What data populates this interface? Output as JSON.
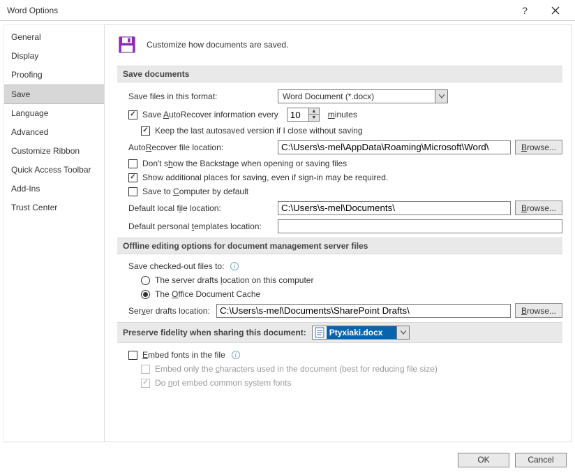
{
  "titlebar": {
    "title": "Word Options",
    "help": "?",
    "close": "×"
  },
  "sidebar": {
    "items": [
      {
        "label": "General"
      },
      {
        "label": "Display"
      },
      {
        "label": "Proofing"
      },
      {
        "label": "Save"
      },
      {
        "label": "Language"
      },
      {
        "label": "Advanced"
      },
      {
        "label": "Customize Ribbon"
      },
      {
        "label": "Quick Access Toolbar"
      },
      {
        "label": "Add-Ins"
      },
      {
        "label": "Trust Center"
      }
    ],
    "selected_index": 3
  },
  "intro": {
    "text": "Customize how documents are saved."
  },
  "save_docs": {
    "header": "Save documents",
    "format_label": "Save files in this format:",
    "format_value": "Word Document (*.docx)",
    "autorecover_prefix": "Save ",
    "autorecover_mid": "utoRecover information every",
    "autorecover_ul": "A",
    "autorecover_minutes": "10",
    "minutes_ul": "m",
    "minutes_rest": "inutes",
    "keep_last": "Keep the last autosaved version if I close without saving",
    "autorec_loc_pre": "Auto",
    "autorec_loc_ul": "R",
    "autorec_loc_post": "ecover file location:",
    "autorec_loc_val": "C:\\Users\\s-mel\\AppData\\Roaming\\Microsoft\\Word\\",
    "dont_show_pre": "Don't s",
    "dont_show_ul": "h",
    "dont_show_post": "ow the Backstage when opening or saving files",
    "show_additional": "Show additional places for saving, even if sign-in may be required.",
    "save_computer_pre": "Save to ",
    "save_computer_ul": "C",
    "save_computer_post": "omputer by default",
    "default_local_pre": "Default local f",
    "default_local_ul": "i",
    "default_local_post": "le location:",
    "default_local_val": "C:\\Users\\s-mel\\Documents\\",
    "default_tmpl_pre": "Default personal ",
    "default_tmpl_ul": "t",
    "default_tmpl_post": "emplates location:",
    "default_tmpl_val": "",
    "browse_ul": "B",
    "browse_rest": "rowse..."
  },
  "offline": {
    "header": "Offline editing options for document management server files",
    "save_checked_out": "Save checked-out files to:",
    "radio1_pre": "The server drafts ",
    "radio1_ul": "l",
    "radio1_post": "ocation on this computer",
    "radio2_pre": "The ",
    "radio2_ul": "O",
    "radio2_post": "ffice Document Cache",
    "server_drafts_pre": "Ser",
    "server_drafts_ul": "v",
    "server_drafts_post": "er drafts location:",
    "server_drafts_val": "C:\\Users\\s-mel\\Documents\\SharePoint Drafts\\"
  },
  "preserve": {
    "header": "Preserve fidelity when sharing this document:",
    "doc_name": "Ptyxiaki.docx",
    "embed_pre": "",
    "embed_ul": "E",
    "embed_post": "mbed fonts in the file",
    "embed_only_pre": "Embed only the ",
    "embed_only_ul": "c",
    "embed_only_post": "haracters used in the document (best for reducing file size)",
    "do_not_pre": "Do ",
    "do_not_ul": "n",
    "do_not_post": "ot embed common system fonts"
  },
  "footer": {
    "ok": "OK",
    "cancel": "Cancel"
  }
}
